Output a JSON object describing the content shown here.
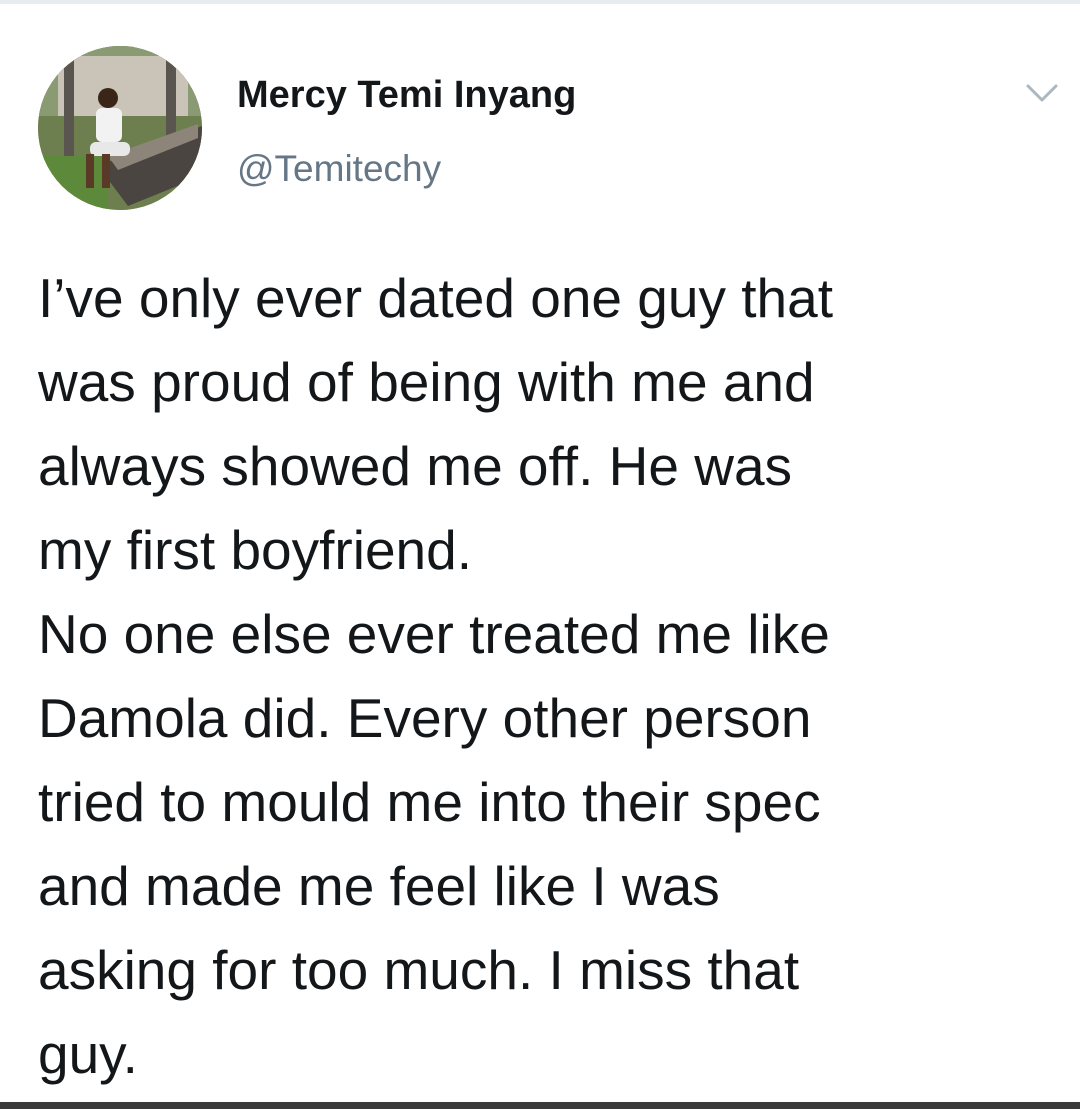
{
  "author": {
    "name": "Mercy Temi Inyang",
    "handle": "@Temitechy"
  },
  "avatar_icon": "profile-photo",
  "menu_icon": "chevron-down-icon",
  "tweet": {
    "lines": [
      "I’ve only ever dated one guy that",
      "was proud of being with me and",
      "always showed me off. He was",
      "my first boyfriend.",
      "No one else ever treated me like",
      "Damola did. Every other person",
      "tried to mould me into their spec",
      "and made me feel like I was",
      "asking for too much. I miss that",
      "guy."
    ]
  },
  "colors": {
    "name": "#14171a",
    "handle": "#657786",
    "chevron": "#aab8c2",
    "border": "#e6ecf0"
  }
}
